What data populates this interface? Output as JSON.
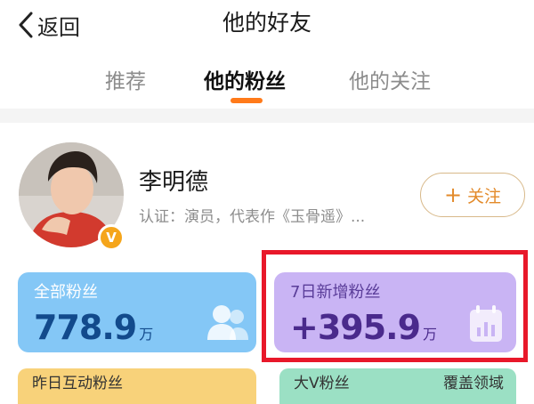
{
  "header": {
    "back_label": "返回",
    "title": "他的好友"
  },
  "tabs": [
    {
      "label": "推荐",
      "active": false
    },
    {
      "label": "他的粉丝",
      "active": true
    },
    {
      "label": "他的关注",
      "active": false
    }
  ],
  "profile": {
    "name": "李明德",
    "certification": "认证：演员，代表作《玉骨遥》...",
    "verified_badge": "V",
    "follow_label": "关注",
    "follow_icon": "+"
  },
  "stats": {
    "all_fans": {
      "label": "全部粉丝",
      "value": "778.9",
      "unit": "万"
    },
    "new_fans_7d": {
      "label": "7日新增粉丝",
      "value": "+395.9",
      "unit": "万"
    },
    "interaction_yesterday": {
      "label": "昨日互动粉丝"
    },
    "big_v": {
      "label": "大V粉丝",
      "coverage": "覆盖领域"
    }
  },
  "colors": {
    "accent": "#ff7a1a",
    "highlight": "#e8182a",
    "card_all": "#84c7f6",
    "card_new": "#c9b4f4",
    "card_interact": "#f8d27a",
    "card_bigv": "#9be0c4"
  }
}
